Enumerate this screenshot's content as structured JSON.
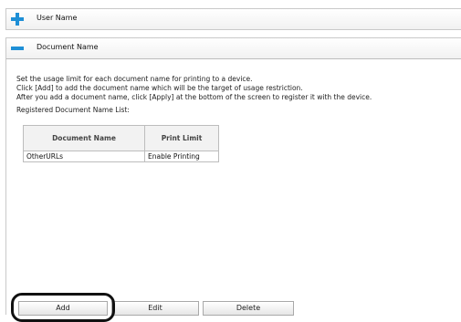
{
  "sections": {
    "user_name": {
      "label": "User Name",
      "icon": "plus-icon"
    },
    "document_name": {
      "label": "Document Name",
      "icon": "minus-icon"
    }
  },
  "description": {
    "line1": "Set the usage limit for each document name for printing to a device.",
    "line2": "Click [Add] to add the document name which will be the target of usage restriction.",
    "line3": "After you add a document name, click [Apply] at the bottom of the screen to register it with the device.",
    "list_title": "Registered Document Name List:"
  },
  "table": {
    "headers": [
      "Document Name",
      "Print Limit"
    ],
    "rows": [
      [
        "OtherURLs",
        "Enable Printing"
      ]
    ]
  },
  "buttons": {
    "add": "Add",
    "edit": "Edit",
    "delete": "Delete"
  },
  "colors": {
    "expand_icon": "#1e8fd6",
    "collapse_icon": "#1e8fd6",
    "highlight_outline": "#111111"
  }
}
